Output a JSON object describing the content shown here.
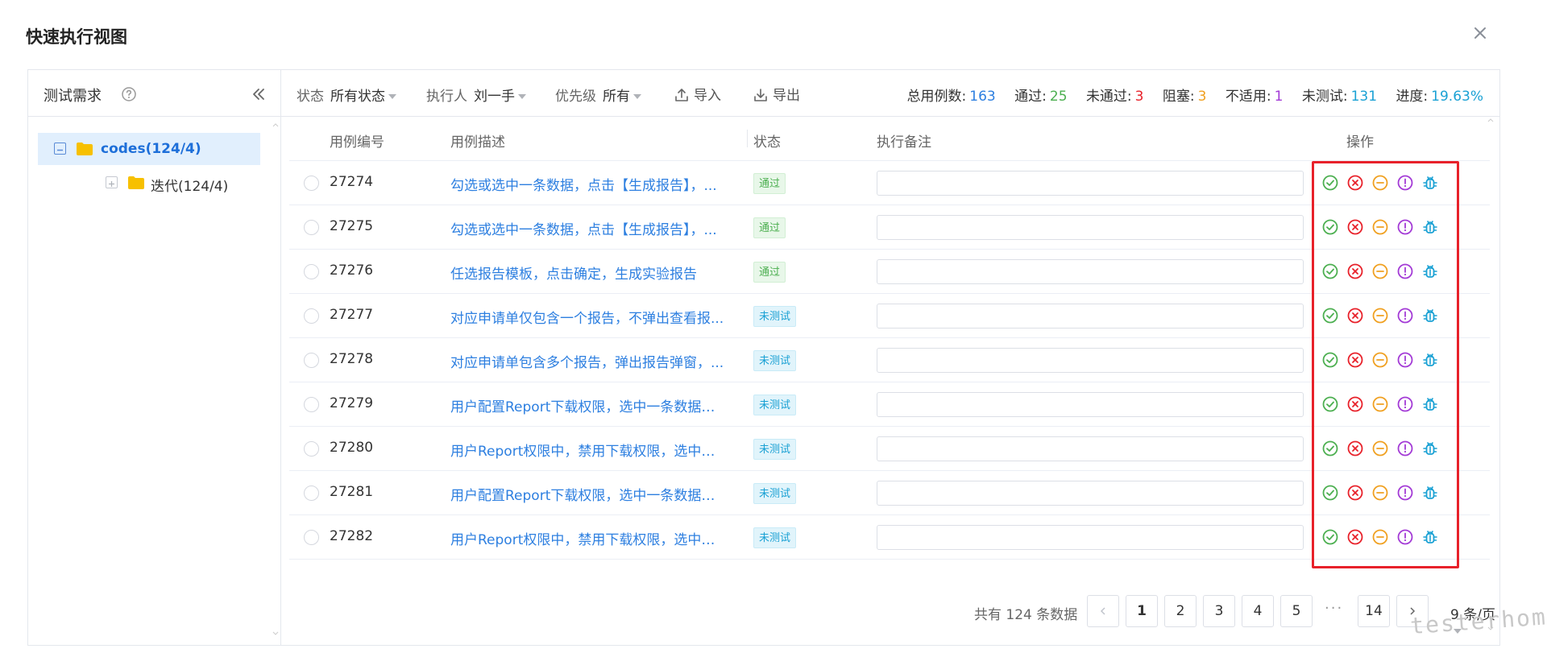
{
  "modal": {
    "title": "快速执行视图"
  },
  "sidebar": {
    "title": "测试需求",
    "tree": [
      {
        "label": "codes(124/4)",
        "selected": true,
        "expanded": true
      },
      {
        "label": "迭代(124/4)",
        "selected": false,
        "expanded": false
      }
    ]
  },
  "toolbar": {
    "status_label": "状态",
    "status_value": "所有状态",
    "executor_label": "执行人",
    "executor_value": "刘一手",
    "priority_label": "优先级",
    "priority_value": "所有",
    "import_label": "导入",
    "export_label": "导出"
  },
  "stats": {
    "total_label": "总用例数:",
    "total": "163",
    "passed_label": "通过:",
    "passed": "25",
    "failed_label": "未通过:",
    "failed": "3",
    "blocked_label": "阻塞:",
    "blocked": "3",
    "na_label": "不适用:",
    "na": "1",
    "untested_label": "未测试:",
    "untested": "131",
    "progress_label": "进度:",
    "progress": "19.63%"
  },
  "colors": {
    "blue": "#2d7fe0",
    "green": "#4caf50",
    "red": "#e8212a",
    "orange": "#f0a020",
    "purple": "#a33ad6",
    "teal": "#1aa1d4"
  },
  "table": {
    "headers": {
      "id": "用例编号",
      "desc": "用例描述",
      "status": "状态",
      "note": "执行备注",
      "ops": "操作"
    },
    "op_icons": [
      "pass-icon",
      "fail-icon",
      "block-icon",
      "not-applicable-icon",
      "bug-icon"
    ],
    "rows": [
      {
        "id": "27274",
        "desc": "勾选或选中一条数据，点击【生成报告】，...",
        "status": "通过",
        "status_type": "pass",
        "note": ""
      },
      {
        "id": "27275",
        "desc": "勾选或选中一条数据，点击【生成报告】，...",
        "status": "通过",
        "status_type": "pass",
        "note": ""
      },
      {
        "id": "27276",
        "desc": "任选报告模板，点击确定，生成实验报告",
        "status": "通过",
        "status_type": "pass",
        "note": ""
      },
      {
        "id": "27277",
        "desc": "对应申请单仅包含一个报告，不弹出查看报...",
        "status": "未测试",
        "status_type": "untested",
        "note": ""
      },
      {
        "id": "27278",
        "desc": "对应申请单包含多个报告，弹出报告弹窗，...",
        "status": "未测试",
        "status_type": "untested",
        "note": ""
      },
      {
        "id": "27279",
        "desc": "用户配置Report下载权限，选中一条数据点...",
        "status": "未测试",
        "status_type": "untested",
        "note": ""
      },
      {
        "id": "27280",
        "desc": "用户Report权限中，禁用下载权限，选中一...",
        "status": "未测试",
        "status_type": "untested",
        "note": ""
      },
      {
        "id": "27281",
        "desc": "用户配置Report下载权限，选中一条数据点...",
        "status": "未测试",
        "status_type": "untested",
        "note": ""
      },
      {
        "id": "27282",
        "desc": "用户Report权限中，禁用下载权限，选中一...",
        "status": "未测试",
        "status_type": "untested",
        "note": ""
      }
    ]
  },
  "pagination": {
    "total_text": "共有 124 条数据",
    "pages": [
      "1",
      "2",
      "3",
      "4",
      "5"
    ],
    "ellipsis": "···",
    "last_page": "14",
    "current_page": "1",
    "per_page": "9 条/页"
  },
  "watermark": "testerhome.com"
}
